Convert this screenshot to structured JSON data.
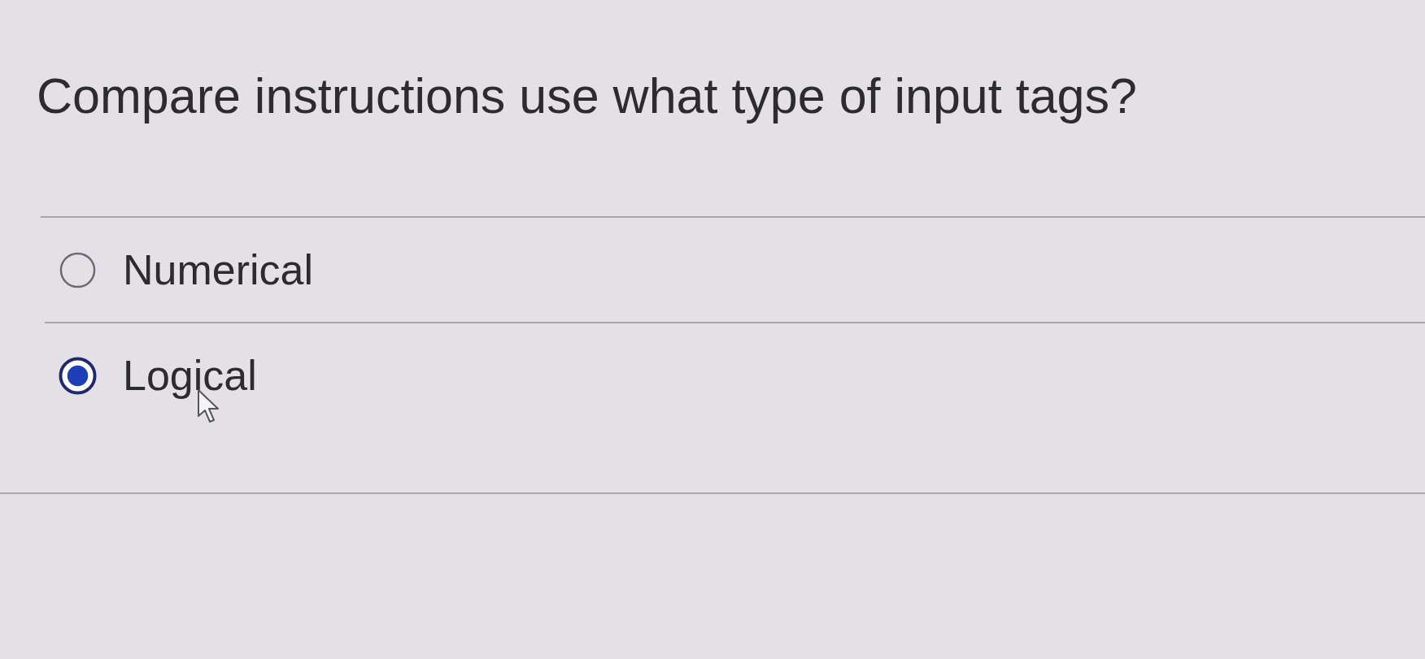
{
  "question": {
    "text": "Compare instructions use what type of input tags?"
  },
  "options": [
    {
      "label": "Numerical",
      "selected": false
    },
    {
      "label": "Logical",
      "selected": true
    }
  ]
}
